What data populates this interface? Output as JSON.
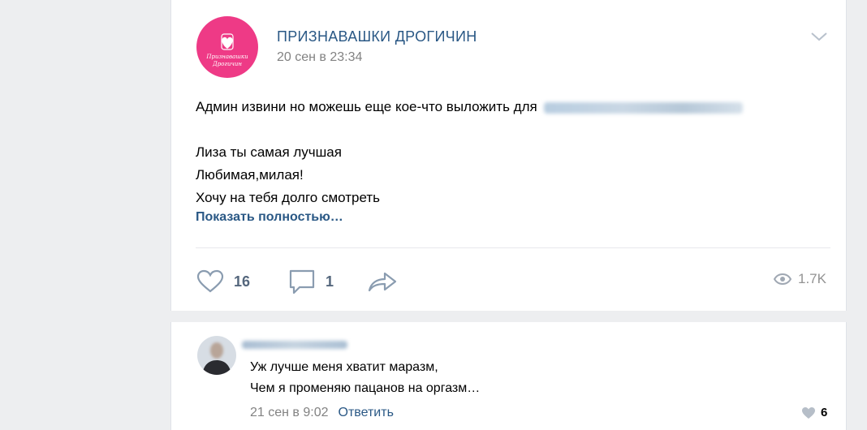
{
  "post": {
    "group_name": "ПРИЗНАВАШКИ ДРОГИЧИН",
    "avatar_text_line1": "Признавашки",
    "avatar_text_line2": "Дрогичин",
    "date": "20 сен в 23:34",
    "text_line1": "Админ извини но можешь еще кое-что выложить для",
    "text_line2": "Лиза ты самая лучшая",
    "text_line3": "Любимая,милая!",
    "text_line4": "Хочу на тебя долго смотреть",
    "show_more": "Показать полностью…",
    "likes": "16",
    "comments": "1",
    "views": "1.7K"
  },
  "comment": {
    "line1": "Уж лучше меня хватит маразм,",
    "line2": "Чем я променяю пацанов на оргазм…",
    "date": "21 сен в 9:02",
    "reply_label": "Ответить",
    "likes": "6"
  },
  "colors": {
    "accent": "#2a5885",
    "avatar_bg": "#ee3a86",
    "page_bg": "#edeef0"
  }
}
